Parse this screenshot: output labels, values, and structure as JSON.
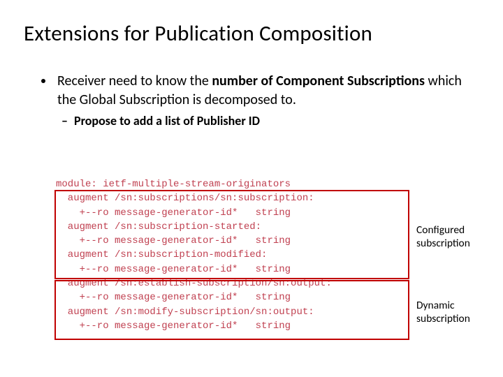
{
  "title": "Extensions for Publication Composition",
  "bullet": {
    "prefix": "Receiver need to know the ",
    "bold": "number of Component Subscriptions",
    "suffix": " which the Global Subscription is decomposed to."
  },
  "sub_bullet": "Propose to add a list of Publisher ID",
  "code": {
    "line01": "module: ietf-multiple-stream-originators",
    "line02": "  augment /sn:subscriptions/sn:subscription:",
    "line03": "    +--ro message-generator-id*   string",
    "line04": "  augment /sn:subscription-started:",
    "line05": "    +--ro message-generator-id*   string",
    "line06": "  augment /sn:subscription-modified:",
    "line07": "    +--ro message-generator-id*   string",
    "line08": "  augment /sn:establish-subscription/sn:output:",
    "line09": "    +--ro message-generator-id*   string",
    "line10": "  augment /sn:modify-subscription/sn:output:",
    "line11": "    +--ro message-generator-id*   string"
  },
  "labels": {
    "configured_l1": "Configured",
    "configured_l2": "subscription",
    "dynamic_l1": "Dynamic",
    "dynamic_l2": "subscription"
  }
}
